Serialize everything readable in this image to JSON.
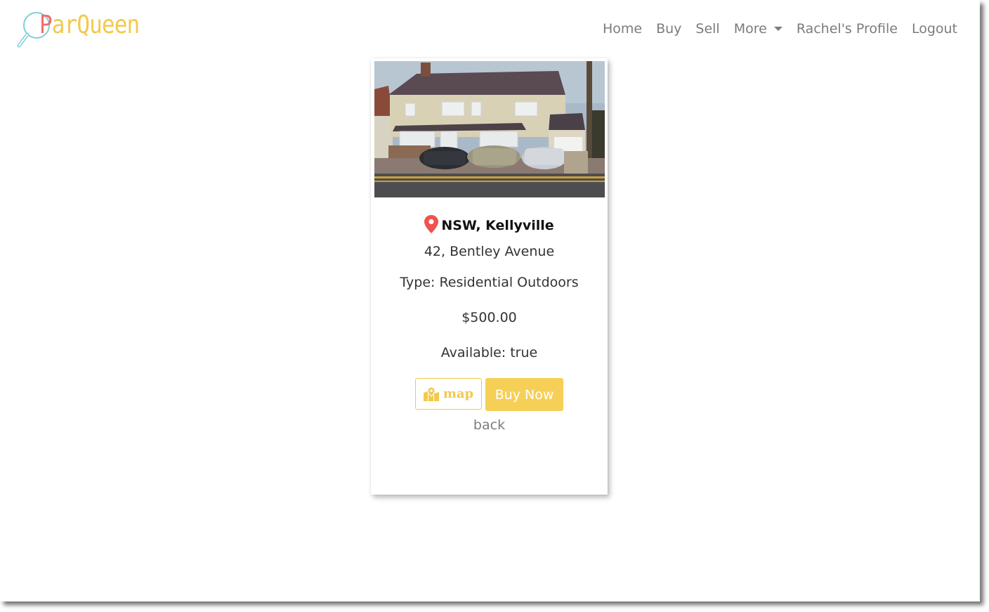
{
  "brand": {
    "name_first_letter": "P",
    "name_rest": "arQueen",
    "logo_icon": "magnifier-icon"
  },
  "nav": {
    "home": "Home",
    "buy": "Buy",
    "sell": "Sell",
    "more": "More",
    "profile": "Rachel's Profile",
    "logout": "Logout"
  },
  "listing": {
    "image_alt": "house-with-parked-cars-photo",
    "location": "NSW, Kellyville",
    "location_icon": "map-pin-icon",
    "address": "42, Bentley Avenue",
    "type": "Type: Residential Outdoors",
    "price": "$500.00",
    "available": "Available: true",
    "map_button": "map",
    "map_icon": "map-marked-icon",
    "buy_button": "Buy Now",
    "back_link": "back"
  },
  "colors": {
    "accent_yellow": "#f2c94c",
    "brand_red": "#ef6f6c",
    "nav_text": "#7c7c7c",
    "pin_red": "#ef5350"
  }
}
